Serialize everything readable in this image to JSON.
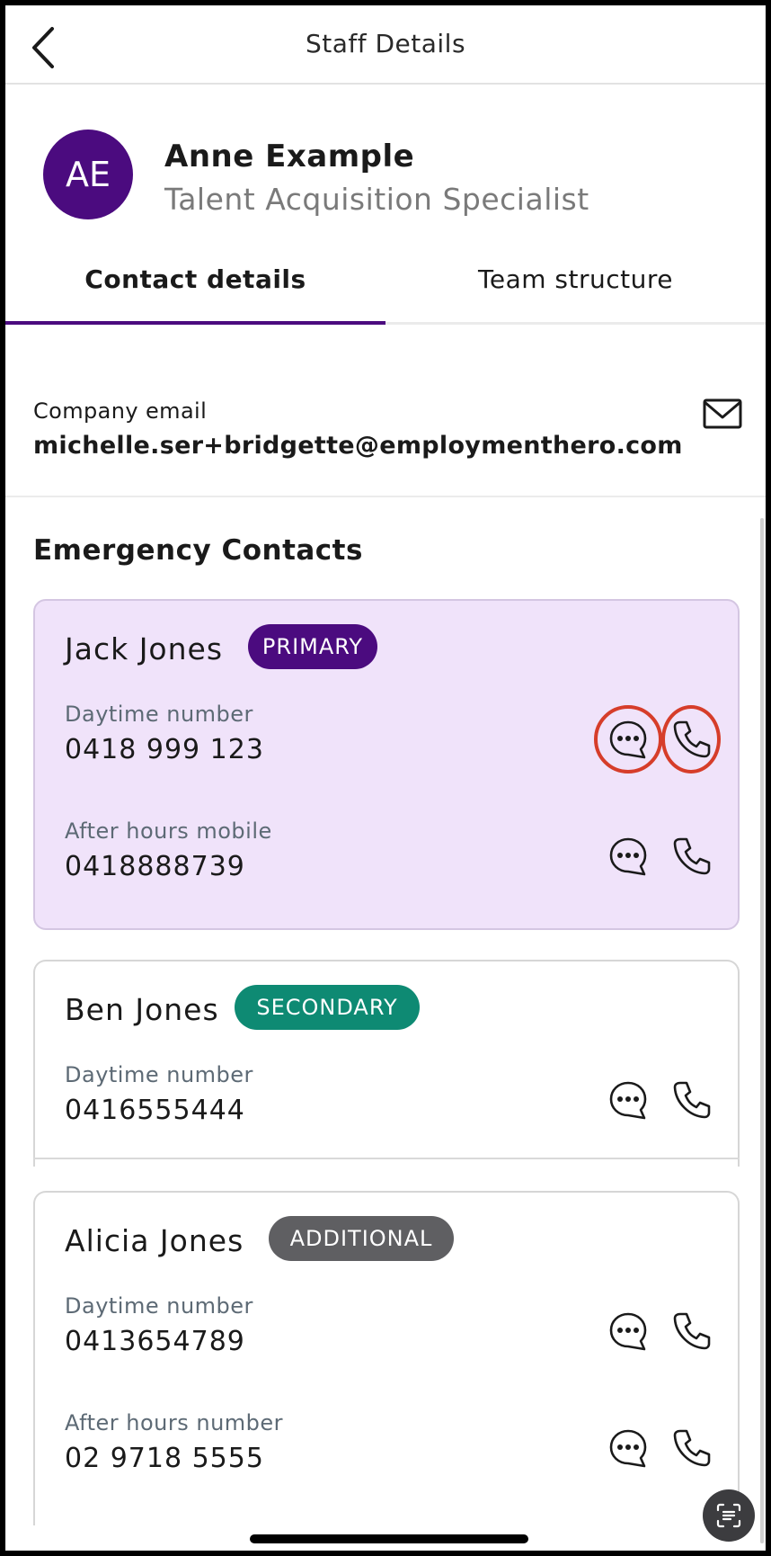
{
  "header": {
    "title": "Staff Details",
    "back_icon": "chevron-left-icon"
  },
  "profile": {
    "initials": "AE",
    "name": "Anne Example",
    "role": "Talent Acquisition Specialist",
    "avatar_color": "#4b0b7f"
  },
  "tabs": [
    {
      "label": "Contact details",
      "active": true
    },
    {
      "label": "Team structure",
      "active": false
    }
  ],
  "email": {
    "label": "Company email",
    "value": "michelle.ser+bridgette@employmenthero.com",
    "icon": "mail-icon"
  },
  "emergency": {
    "title": "Emergency Contacts",
    "contacts": [
      {
        "name": "Jack Jones",
        "badge": "PRIMARY",
        "badge_color": "#4b0b7f",
        "numbers": [
          {
            "label": "Daytime number",
            "value": "0418 999 123"
          },
          {
            "label": "After hours mobile",
            "value": "0418888739"
          }
        ]
      },
      {
        "name": "Ben Jones",
        "badge": "SECONDARY",
        "badge_color": "#0e8a73",
        "numbers": [
          {
            "label": "Daytime number",
            "value": "0416555444"
          }
        ]
      },
      {
        "name": "Alicia Jones",
        "badge": "ADDITIONAL",
        "badge_color": "#5f5f62",
        "numbers": [
          {
            "label": "Daytime number",
            "value": "0413654789"
          },
          {
            "label": "After hours number",
            "value": "02 9718 5555"
          }
        ]
      }
    ]
  },
  "colors": {
    "accent": "#4b0b7f",
    "primary_card_bg": "#f0e3fa",
    "highlight_ring": "#d63d2a"
  }
}
